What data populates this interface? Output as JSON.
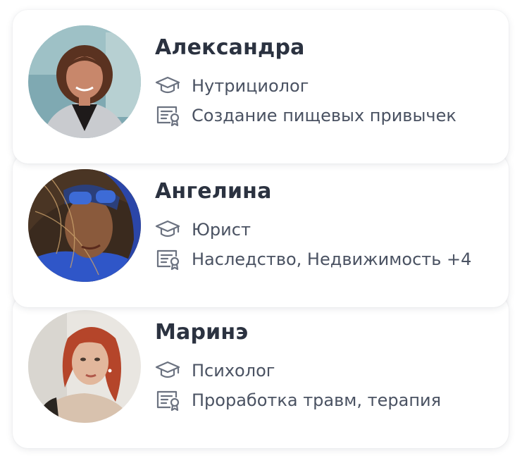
{
  "experts": [
    {
      "name": "Александра",
      "profession": "Нутрициолог",
      "specialization": "Создание пищевых привычек",
      "avatar": {
        "bg": "#7aa6b0",
        "skin": "#c8876b",
        "hair": "#5a3220",
        "clothes": "#c9cbcf"
      }
    },
    {
      "name": "Ангелина",
      "profession": "Юрист",
      "specialization": "Наследство, Недвижимость +4",
      "avatar": {
        "bg": "#3a2a1e",
        "skin": "#8a5a3c",
        "hair": "#2b3f7a",
        "clothes": "#2f56c8"
      }
    },
    {
      "name": "Маринэ",
      "profession": "Психолог",
      "specialization": "Проработка травм, терапия",
      "avatar": {
        "bg": "#e6e3de",
        "skin": "#e2b79c",
        "hair": "#b5452a",
        "clothes": "#2a2520"
      }
    }
  ],
  "icons": {
    "profession": "graduation-cap-icon",
    "specialization": "certificate-icon"
  },
  "colors": {
    "name_text": "#2b3240",
    "body_text": "#4a5262",
    "card_bg": "#ffffff"
  }
}
